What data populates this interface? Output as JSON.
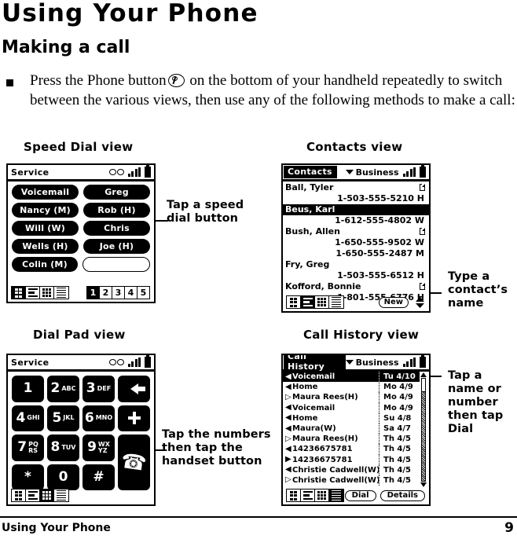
{
  "document": {
    "title": "Using Your Phone",
    "section": "Making a call",
    "bullet_text_1": "Press the Phone button",
    "bullet_text_2": "on the bottom of your handheld repeatedly to switch between the various views, then use any of the following methods to make a call:",
    "footer_left": "Using Your Phone",
    "footer_page": "9"
  },
  "speed_dial": {
    "caption": "Speed Dial view",
    "titlebar": {
      "label": "Service",
      "voicemail_icon": "voicemail-icon",
      "signal_icon": "signal-bars-icon",
      "battery_icon": "battery-icon"
    },
    "buttons": [
      [
        "Voicemail",
        "Greg"
      ],
      [
        "Nancy (M)",
        "Rob (H)"
      ],
      [
        "Will (W)",
        "Chris"
      ],
      [
        "Wells (H)",
        "Joe (H)"
      ],
      [
        "Colin (M)",
        ""
      ]
    ],
    "pages": [
      "1",
      "2",
      "3",
      "4",
      "5"
    ],
    "selected_page": "1",
    "selected_view": "speed-dial",
    "callout": "Tap a speed\ndial button"
  },
  "contacts": {
    "caption": "Contacts view",
    "titlebar": {
      "tab": "Contacts",
      "category": "Business",
      "signal_icon": "signal-bars-icon",
      "battery_icon": "battery-icon"
    },
    "rows": [
      {
        "name": "Ball, Tyler",
        "note": true,
        "selected": false,
        "numbers": [
          "1-503-555-5210 H"
        ]
      },
      {
        "name": "Beus, Karl",
        "note": false,
        "selected": true,
        "numbers": [
          "1-612-555-4802 W"
        ]
      },
      {
        "name": "Bush, Allen",
        "note": true,
        "selected": false,
        "numbers": [
          "1-650-555-9502 W",
          "1-650-555-2487 M"
        ]
      },
      {
        "name": "Fry, Greg",
        "note": false,
        "selected": false,
        "numbers": [
          "1-503-555-6512 H"
        ]
      },
      {
        "name": "Kofford, Bonnie",
        "note": true,
        "selected": false,
        "numbers": [
          "1-801-555-6776 H"
        ]
      }
    ],
    "new_button": "New",
    "selected_view": "contacts",
    "callout": "Type a\ncontact’s\nname"
  },
  "dial_pad": {
    "caption": "Dial Pad view",
    "titlebar": {
      "label": "Service",
      "voicemail_icon": "voicemail-icon",
      "signal_icon": "signal-bars-icon",
      "battery_icon": "battery-icon"
    },
    "keys": [
      {
        "digit": "1",
        "letters": ""
      },
      {
        "digit": "2",
        "letters": "ABC"
      },
      {
        "digit": "3",
        "letters": "DEF"
      },
      {
        "digit": "",
        "letters": "",
        "icon": "backspace-icon"
      },
      {
        "digit": "4",
        "letters": "GHI"
      },
      {
        "digit": "5",
        "letters": "JKL"
      },
      {
        "digit": "6",
        "letters": "MNO"
      },
      {
        "digit": "",
        "letters": "",
        "icon": "plus-icon"
      },
      {
        "digit": "7",
        "letters": "PQ RS"
      },
      {
        "digit": "8",
        "letters": "TUV"
      },
      {
        "digit": "9",
        "letters": "WX YZ"
      },
      {
        "digit": "",
        "letters": "",
        "icon": "handset-icon"
      },
      {
        "digit": "*",
        "letters": ""
      },
      {
        "digit": "0",
        "letters": ""
      },
      {
        "digit": "#",
        "letters": ""
      }
    ],
    "selected_view": "dial-pad",
    "callout": "Tap the numbers\nthen tap the\nhandset button"
  },
  "call_history": {
    "caption": "Call History view",
    "titlebar": {
      "tab": "Call History",
      "category": "Business",
      "signal_icon": "signal-bars-icon",
      "battery_icon": "battery-icon"
    },
    "rows": [
      {
        "dir": "in",
        "name": "Voicemail",
        "date": "Tu 4/10",
        "selected": true
      },
      {
        "dir": "in",
        "name": "Home",
        "date": "Mo 4/9",
        "selected": false
      },
      {
        "dir": "mis",
        "name": "Maura Rees(H)",
        "date": "Mo 4/9",
        "selected": false
      },
      {
        "dir": "in",
        "name": "Voicemail",
        "date": "Mo 4/9",
        "selected": false
      },
      {
        "dir": "in",
        "name": "Home",
        "date": "Su 4/8",
        "selected": false
      },
      {
        "dir": "in",
        "name": "Maura(W)",
        "date": "Sa 4/7",
        "selected": false
      },
      {
        "dir": "mis",
        "name": "Maura Rees(H)",
        "date": "Th 4/5",
        "selected": false
      },
      {
        "dir": "in",
        "name": "14236675781",
        "date": "Th 4/5",
        "selected": false
      },
      {
        "dir": "out",
        "name": "14236675781",
        "date": "Th 4/5",
        "selected": false
      },
      {
        "dir": "in",
        "name": "Christie Cadwell(W)",
        "date": "Th 4/5",
        "selected": false
      },
      {
        "dir": "mis",
        "name": "Christie Cadwell(W)",
        "date": "Th 4/5",
        "selected": false
      }
    ],
    "dial_button": "Dial",
    "details_button": "Details",
    "selected_view": "call-history",
    "callout": "Tap a\nname or\nnumber\nthen tap\nDial"
  }
}
